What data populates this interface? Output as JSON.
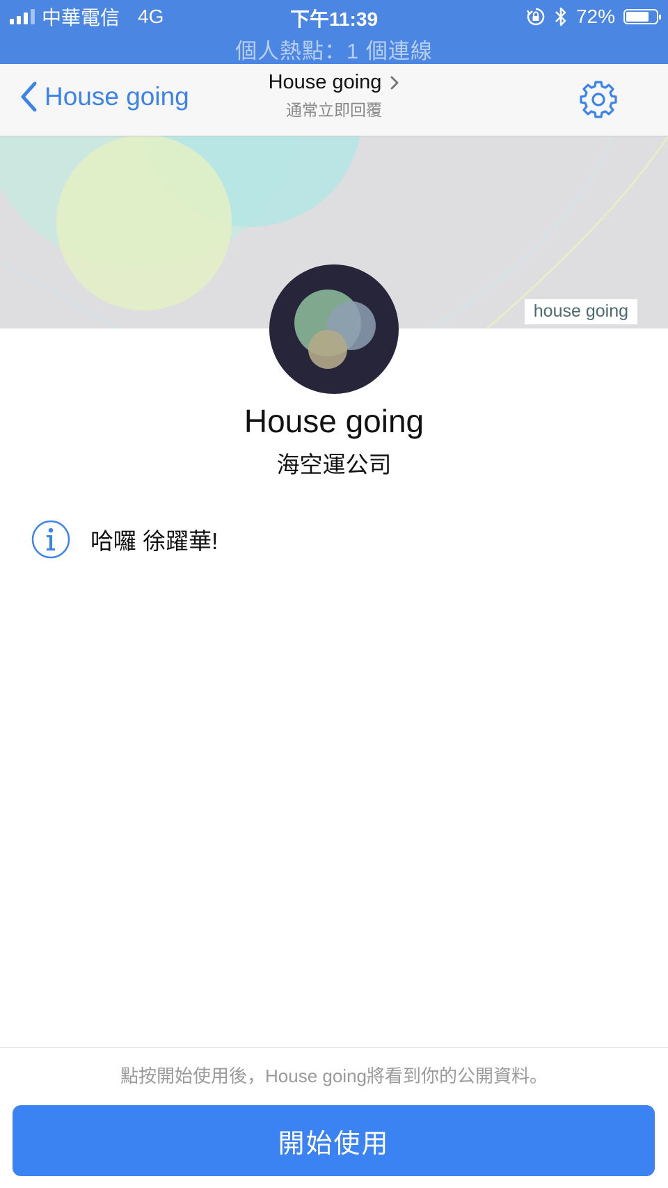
{
  "status_bar": {
    "carrier": "中華電信",
    "network": "4G",
    "time": "下午11:39",
    "battery_percent": "72%",
    "battery_level": 0.72,
    "hotspot_text": "個人熱點：1 個連線"
  },
  "nav": {
    "back_label": "House going",
    "title": "House going",
    "subtitle": "通常立即回覆"
  },
  "cover": {
    "label": "house going"
  },
  "profile": {
    "name": "House going",
    "category": "海空運公司"
  },
  "info": {
    "greeting": "哈囉 徐躍華!"
  },
  "footer": {
    "disclaimer": "點按開始使用後，House going將看到你的公開資料。",
    "start_button": "開始使用"
  },
  "colors": {
    "status_bar": "#4a86e2",
    "accent": "#3b83eb",
    "button": "#3b82f3"
  }
}
